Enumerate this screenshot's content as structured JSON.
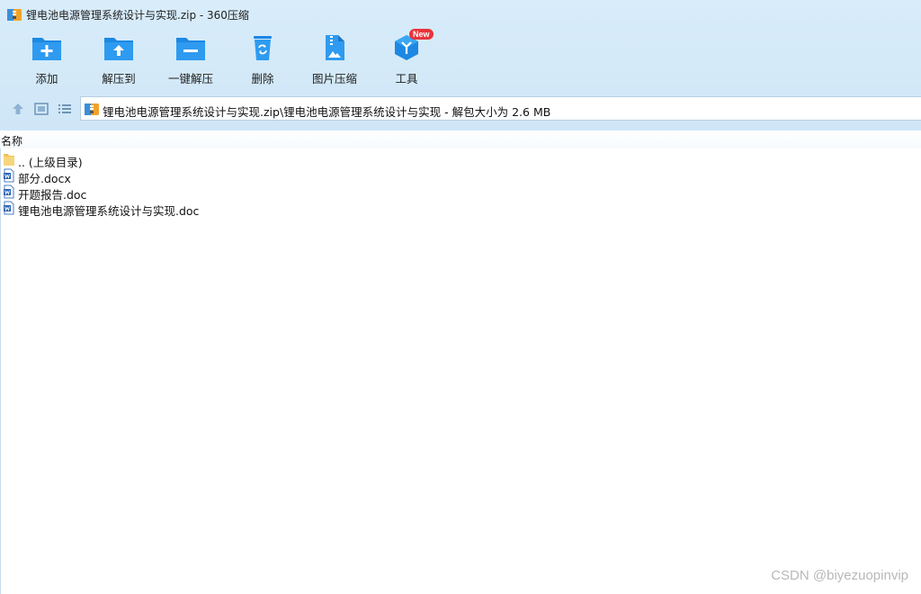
{
  "window": {
    "title": "锂电池电源管理系统设计与实现.zip - 360压缩",
    "app_icon": "zip-archive-icon"
  },
  "toolbar": {
    "buttons": [
      {
        "label": "添加",
        "icon": "add-folder-icon"
      },
      {
        "label": "解压到",
        "icon": "extract-to-folder-icon"
      },
      {
        "label": "一键解压",
        "icon": "one-click-extract-icon"
      },
      {
        "label": "删除",
        "icon": "recycle-bin-icon"
      },
      {
        "label": "图片压缩",
        "icon": "image-compress-icon"
      },
      {
        "label": "工具",
        "icon": "tools-cube-icon",
        "badge": "New"
      }
    ]
  },
  "nav": {
    "up_icon": "up-arrow-icon",
    "view_icon": "thumbnail-view-icon",
    "list_icon": "list-view-icon",
    "address": "锂电池电源管理系统设计与实现.zip\\锂电池电源管理系统设计与实现 - 解包大小为 2.6 MB"
  },
  "columns": {
    "name": "名称"
  },
  "files": [
    {
      "name": ".. (上级目录)",
      "icon": "folder-icon"
    },
    {
      "name": "部分.docx",
      "icon": "word-document-icon"
    },
    {
      "name": "开题报告.doc",
      "icon": "word-document-icon"
    },
    {
      "name": "锂电池电源管理系统设计与实现.doc",
      "icon": "word-document-icon"
    }
  ],
  "watermark": "CSDN @biyezuopinvip",
  "colors": {
    "accent_blue": "#1e8be6",
    "chrome_bg": "#d6ebf9",
    "badge_red": "#e8343b"
  }
}
